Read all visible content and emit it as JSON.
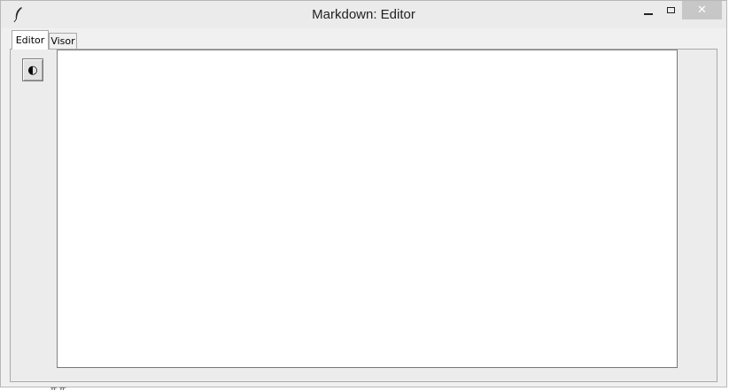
{
  "window": {
    "title": "Markdown: Editor",
    "close_glyph": "✕"
  },
  "tabs": [
    {
      "label": "Editor",
      "active": true
    },
    {
      "label": "Visor",
      "active": false
    }
  ],
  "toolbar": {
    "theme_toggle_glyph": "◐"
  },
  "editor": {
    "content": ""
  },
  "background": {
    "fragments": [
      "## "
    ]
  },
  "colors": {
    "titlebar": "#ebebeb",
    "close_button": "#c7c7c7",
    "panel": "#ececec",
    "editor_bg": "#ffffff"
  }
}
